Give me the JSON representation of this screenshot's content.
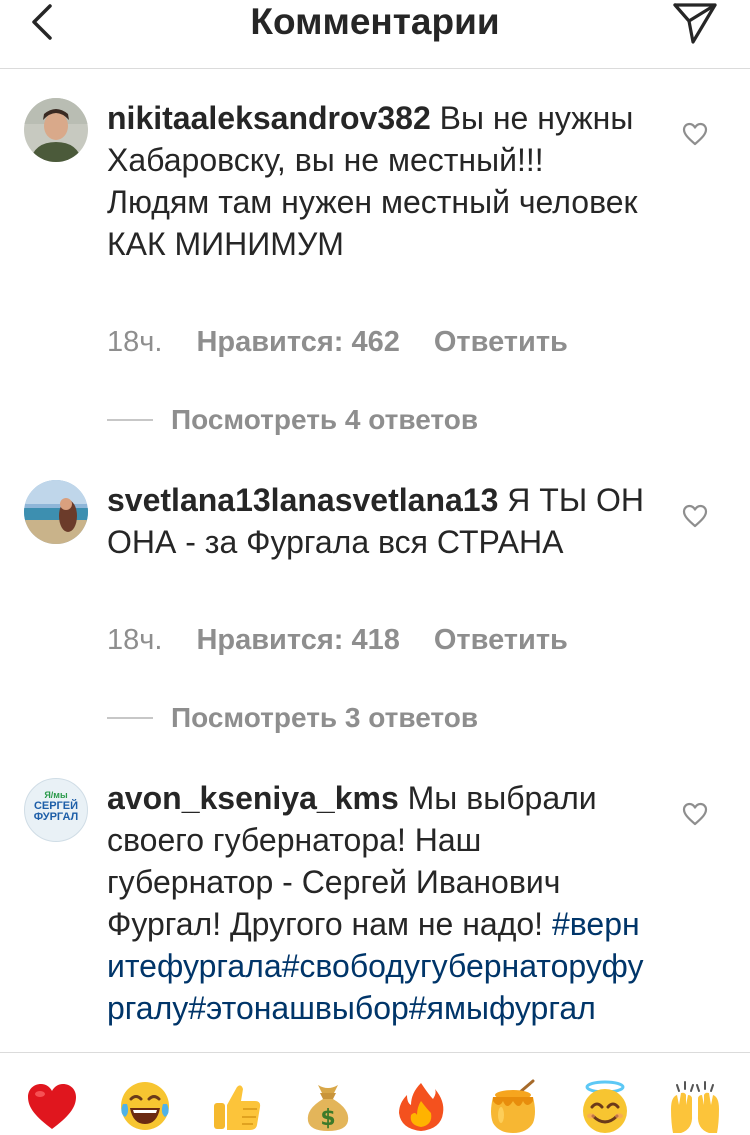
{
  "header": {
    "title": "Комментарии"
  },
  "comments": [
    {
      "username": "nikitaaleksandrov382",
      "text": "Вы не нужны Хабаровску, вы не местный!!! Людям там нужен местный человек КАК МИНИМУМ",
      "time": "18ч.",
      "likes": "Нравится: 462",
      "reply": "Ответить",
      "view_replies": "Посмотреть 4 ответов"
    },
    {
      "username": "svetlana13lanasvetlana13",
      "text": "Я ТЫ ОН ОНА - за Фургала вся СТРАНА",
      "time": "18ч.",
      "likes": "Нравится: 418",
      "reply": "Ответить",
      "view_replies": "Посмотреть 3 ответов"
    },
    {
      "username": "avon_kseniya_kms",
      "text": "Мы выбрали своего губернатора! Наш губернатор - Сергей Иванович Фургал! Другого нам не надо!",
      "hashtags": "#вернитефургала#свободугубернаторуфургалу#этонашвыбор#ямыфургал",
      "avatar_text": [
        "Я/мы",
        "СЕРГЕЙ",
        "ФУРГАЛ"
      ]
    }
  ],
  "emoji_bar": [
    "red-heart",
    "tears-of-joy",
    "thumbs-up",
    "money-bag",
    "fire",
    "honey-pot",
    "smiling-face-with-halo",
    "raising-hands"
  ],
  "colors": {
    "hashtag": "#003569",
    "meta": "#8e8e8e",
    "text": "#262626"
  }
}
